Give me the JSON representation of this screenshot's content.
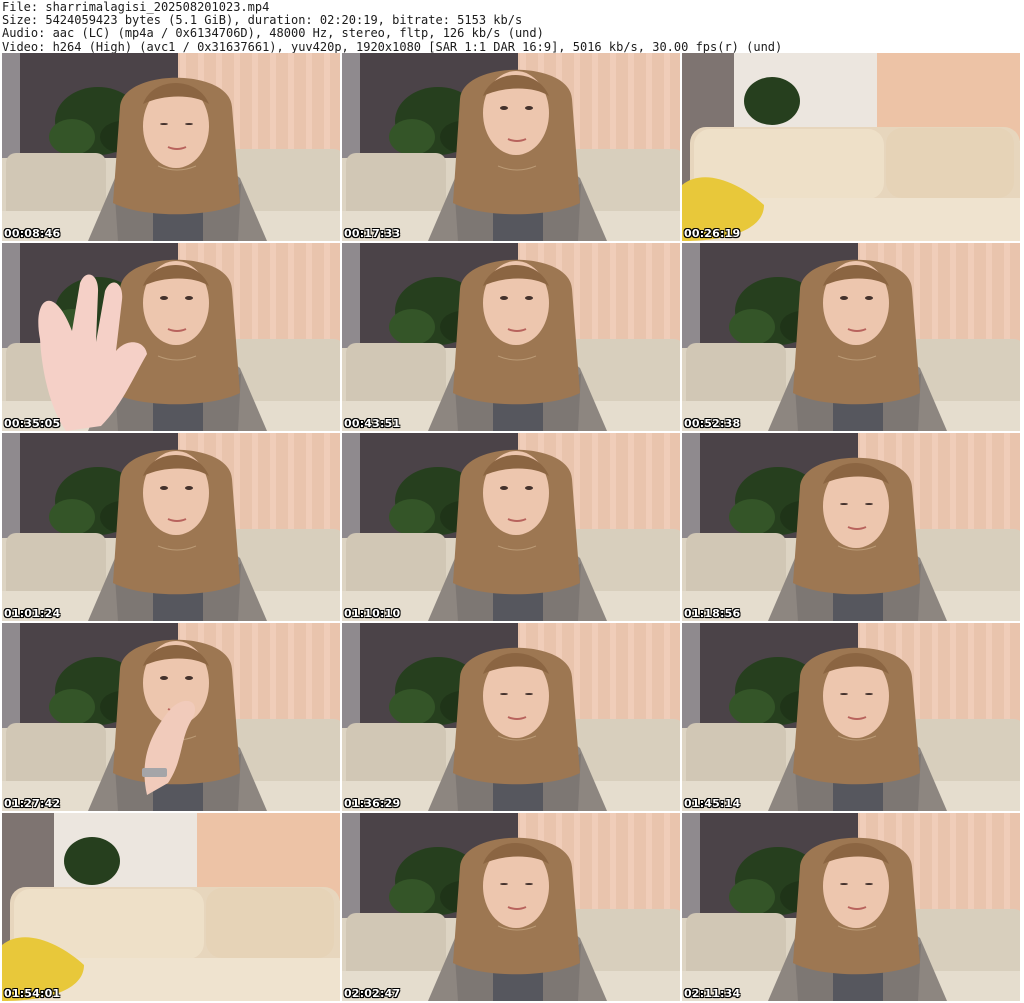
{
  "header": {
    "file": "File: sharrimalagisi_202508201023.mp4",
    "size": "Size: 5424059423 bytes (5.1 GiB), duration: 02:20:19, bitrate: 5153 kb/s",
    "audio": "Audio: aac (LC) (mp4a / 0x6134706D), 48000 Hz, stereo, fltp, 126 kb/s (und)",
    "video": "Video: h264 (High) (avc1 / 0x31637661), yuv420p, 1920x1080 [SAR 1:1 DAR 16:9], 5016 kb/s, 30.00 fps(r) (und)"
  },
  "colors": {
    "wall": "#4b4348",
    "curtain": "#e9c4ad",
    "sofa": "#ddd4c3",
    "hoodie": "#8d8680",
    "hair": "#9d7752",
    "skin": "#edc6ae",
    "plant": "#263f1e",
    "pillow": "#e8c83a"
  },
  "thumbnails": [
    {
      "time": "00:08:46",
      "scene": "person",
      "pose": "down",
      "gesture": "none"
    },
    {
      "time": "00:17:33",
      "scene": "person",
      "pose": "front",
      "gesture": "none"
    },
    {
      "time": "00:26:19",
      "scene": "sofa",
      "pose": "empty",
      "gesture": "none"
    },
    {
      "time": "00:35:05",
      "scene": "person",
      "pose": "front",
      "gesture": "hand"
    },
    {
      "time": "00:43:51",
      "scene": "person",
      "pose": "front",
      "gesture": "none"
    },
    {
      "time": "00:52:38",
      "scene": "person",
      "pose": "front",
      "gesture": "none"
    },
    {
      "time": "01:01:24",
      "scene": "person",
      "pose": "front",
      "gesture": "none"
    },
    {
      "time": "01:10:10",
      "scene": "person",
      "pose": "front",
      "gesture": "none"
    },
    {
      "time": "01:18:56",
      "scene": "person",
      "pose": "down",
      "gesture": "none"
    },
    {
      "time": "01:27:42",
      "scene": "person",
      "pose": "front",
      "gesture": "face"
    },
    {
      "time": "01:36:29",
      "scene": "person",
      "pose": "down",
      "gesture": "none"
    },
    {
      "time": "01:45:14",
      "scene": "person",
      "pose": "down",
      "gesture": "none"
    },
    {
      "time": "01:54:01",
      "scene": "sofa",
      "pose": "empty",
      "gesture": "none"
    },
    {
      "time": "02:02:47",
      "scene": "person",
      "pose": "down",
      "gesture": "none"
    },
    {
      "time": "02:11:34",
      "scene": "person",
      "pose": "down",
      "gesture": "none"
    }
  ]
}
